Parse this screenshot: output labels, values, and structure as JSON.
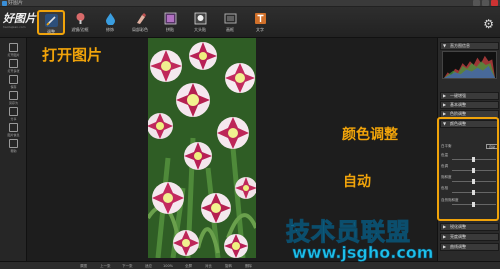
{
  "window": {
    "title": "好图片"
  },
  "logo": {
    "name": "好图片",
    "tagline": "haotupian.com"
  },
  "toolbar": {
    "tools": [
      {
        "label": "调整",
        "icon": "pen-icon",
        "color": "#7aa6d8"
      },
      {
        "label": "滤镜/边框",
        "icon": "brush-icon",
        "color": "#d86a6a"
      },
      {
        "label": "修饰",
        "icon": "drop-icon",
        "color": "#3a9ee0"
      },
      {
        "label": "局部彩色",
        "icon": "paint-icon",
        "color": "#e0b0a0"
      },
      {
        "label": "拼贴",
        "icon": "collage-icon",
        "color": "#b070c0"
      },
      {
        "label": "大头贴",
        "icon": "sticker-icon",
        "color": "#f0f0f0"
      },
      {
        "label": "画框",
        "icon": "frame-icon",
        "color": "#909090"
      },
      {
        "label": "文字",
        "icon": "text-icon",
        "color": "#d0702a"
      }
    ]
  },
  "sidebar": {
    "items": [
      {
        "label": "打开图片",
        "icon": "open-folder-icon"
      },
      {
        "label": "打开多张",
        "icon": "open-multi-icon"
      },
      {
        "label": "保存",
        "icon": "save-icon"
      },
      {
        "label": "另存为",
        "icon": "save-as-icon"
      },
      {
        "label": "分享",
        "icon": "share-icon"
      },
      {
        "label": "图片信息",
        "icon": "info-icon"
      },
      {
        "label": "帮助",
        "icon": "help-icon"
      }
    ]
  },
  "right_panel": {
    "sections": [
      {
        "title": "直方图信息"
      },
      {
        "title": "一键增强"
      },
      {
        "title": "基本调整"
      },
      {
        "title": "色阶调整"
      },
      {
        "title": "颜色调整"
      },
      {
        "title": "锐化调整"
      },
      {
        "title": "亮度调整"
      },
      {
        "title": "曲线调整"
      }
    ],
    "auto_label": "自动",
    "color_rows": [
      "白平衡",
      "色温",
      "色调",
      "饱和度",
      "色相",
      "自然饱和度"
    ]
  },
  "bottom": {
    "items": [
      "原图",
      "上一张",
      "下一张",
      "适应",
      "100%",
      "全屏",
      "对比",
      "旋转",
      "删除"
    ]
  },
  "annotations": {
    "open_picture": "打开图片",
    "color_adjust": "颜色调整",
    "auto": "自动"
  },
  "watermark": {
    "text": "技术员联盟",
    "url": "www.jsgho.com"
  },
  "colors": {
    "accent": "#f0a30a",
    "watermark": "#1ec0ea"
  }
}
